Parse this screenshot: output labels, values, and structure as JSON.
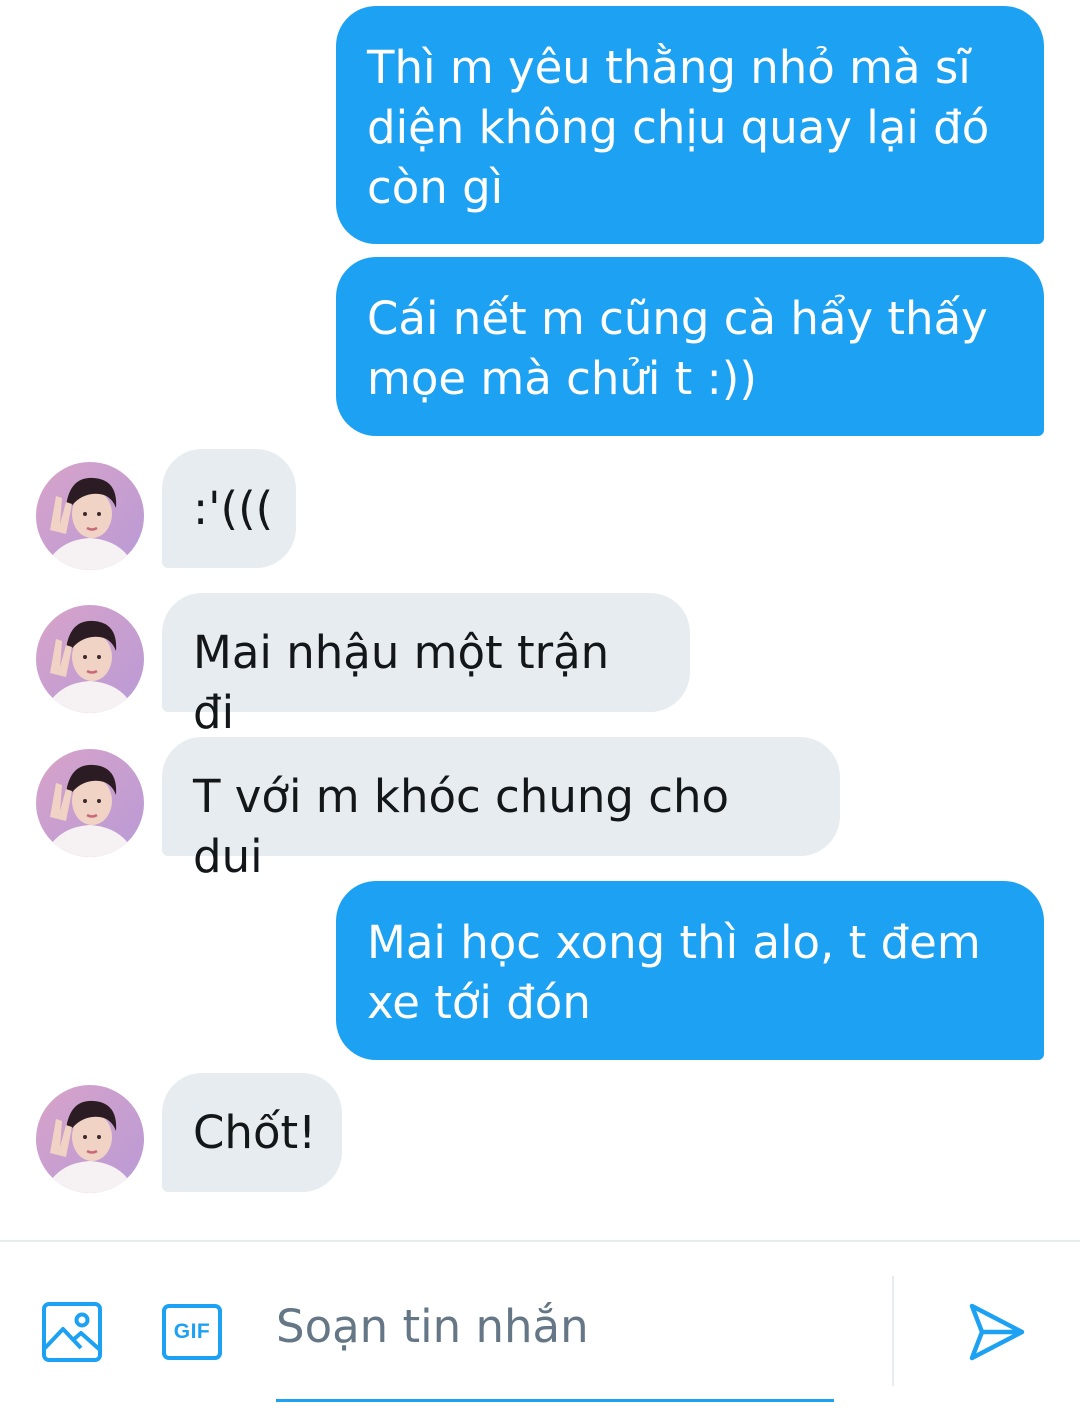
{
  "messages": [
    {
      "direction": "out",
      "text": "Thì m yêu thằng nhỏ mà sĩ\ndiện không chịu quay lại đó\ncòn gì"
    },
    {
      "direction": "out",
      "text": "Cái nết m cũng cà hẩy thấy\nmọe mà chửi t :))"
    },
    {
      "direction": "in",
      "text": ":'((("
    },
    {
      "direction": "in",
      "text": "Mai nhậu một trận đi"
    },
    {
      "direction": "in",
      "text": "T với m khóc chung cho dui"
    },
    {
      "direction": "out",
      "text": "Mai học xong thì alo, t đem\nxe tới đón"
    },
    {
      "direction": "in",
      "text": "Chốt!"
    }
  ],
  "composer": {
    "placeholder": "Soạn tin nhắn",
    "value": "",
    "gif_label": "GIF",
    "media_icon": "image-icon",
    "send_icon": "send-icon"
  },
  "colors": {
    "accent": "#1da1f2",
    "incoming_bubble": "#e6ecf0",
    "outgoing_text": "#ffffff",
    "incoming_text": "#14171a",
    "placeholder": "#657786"
  }
}
